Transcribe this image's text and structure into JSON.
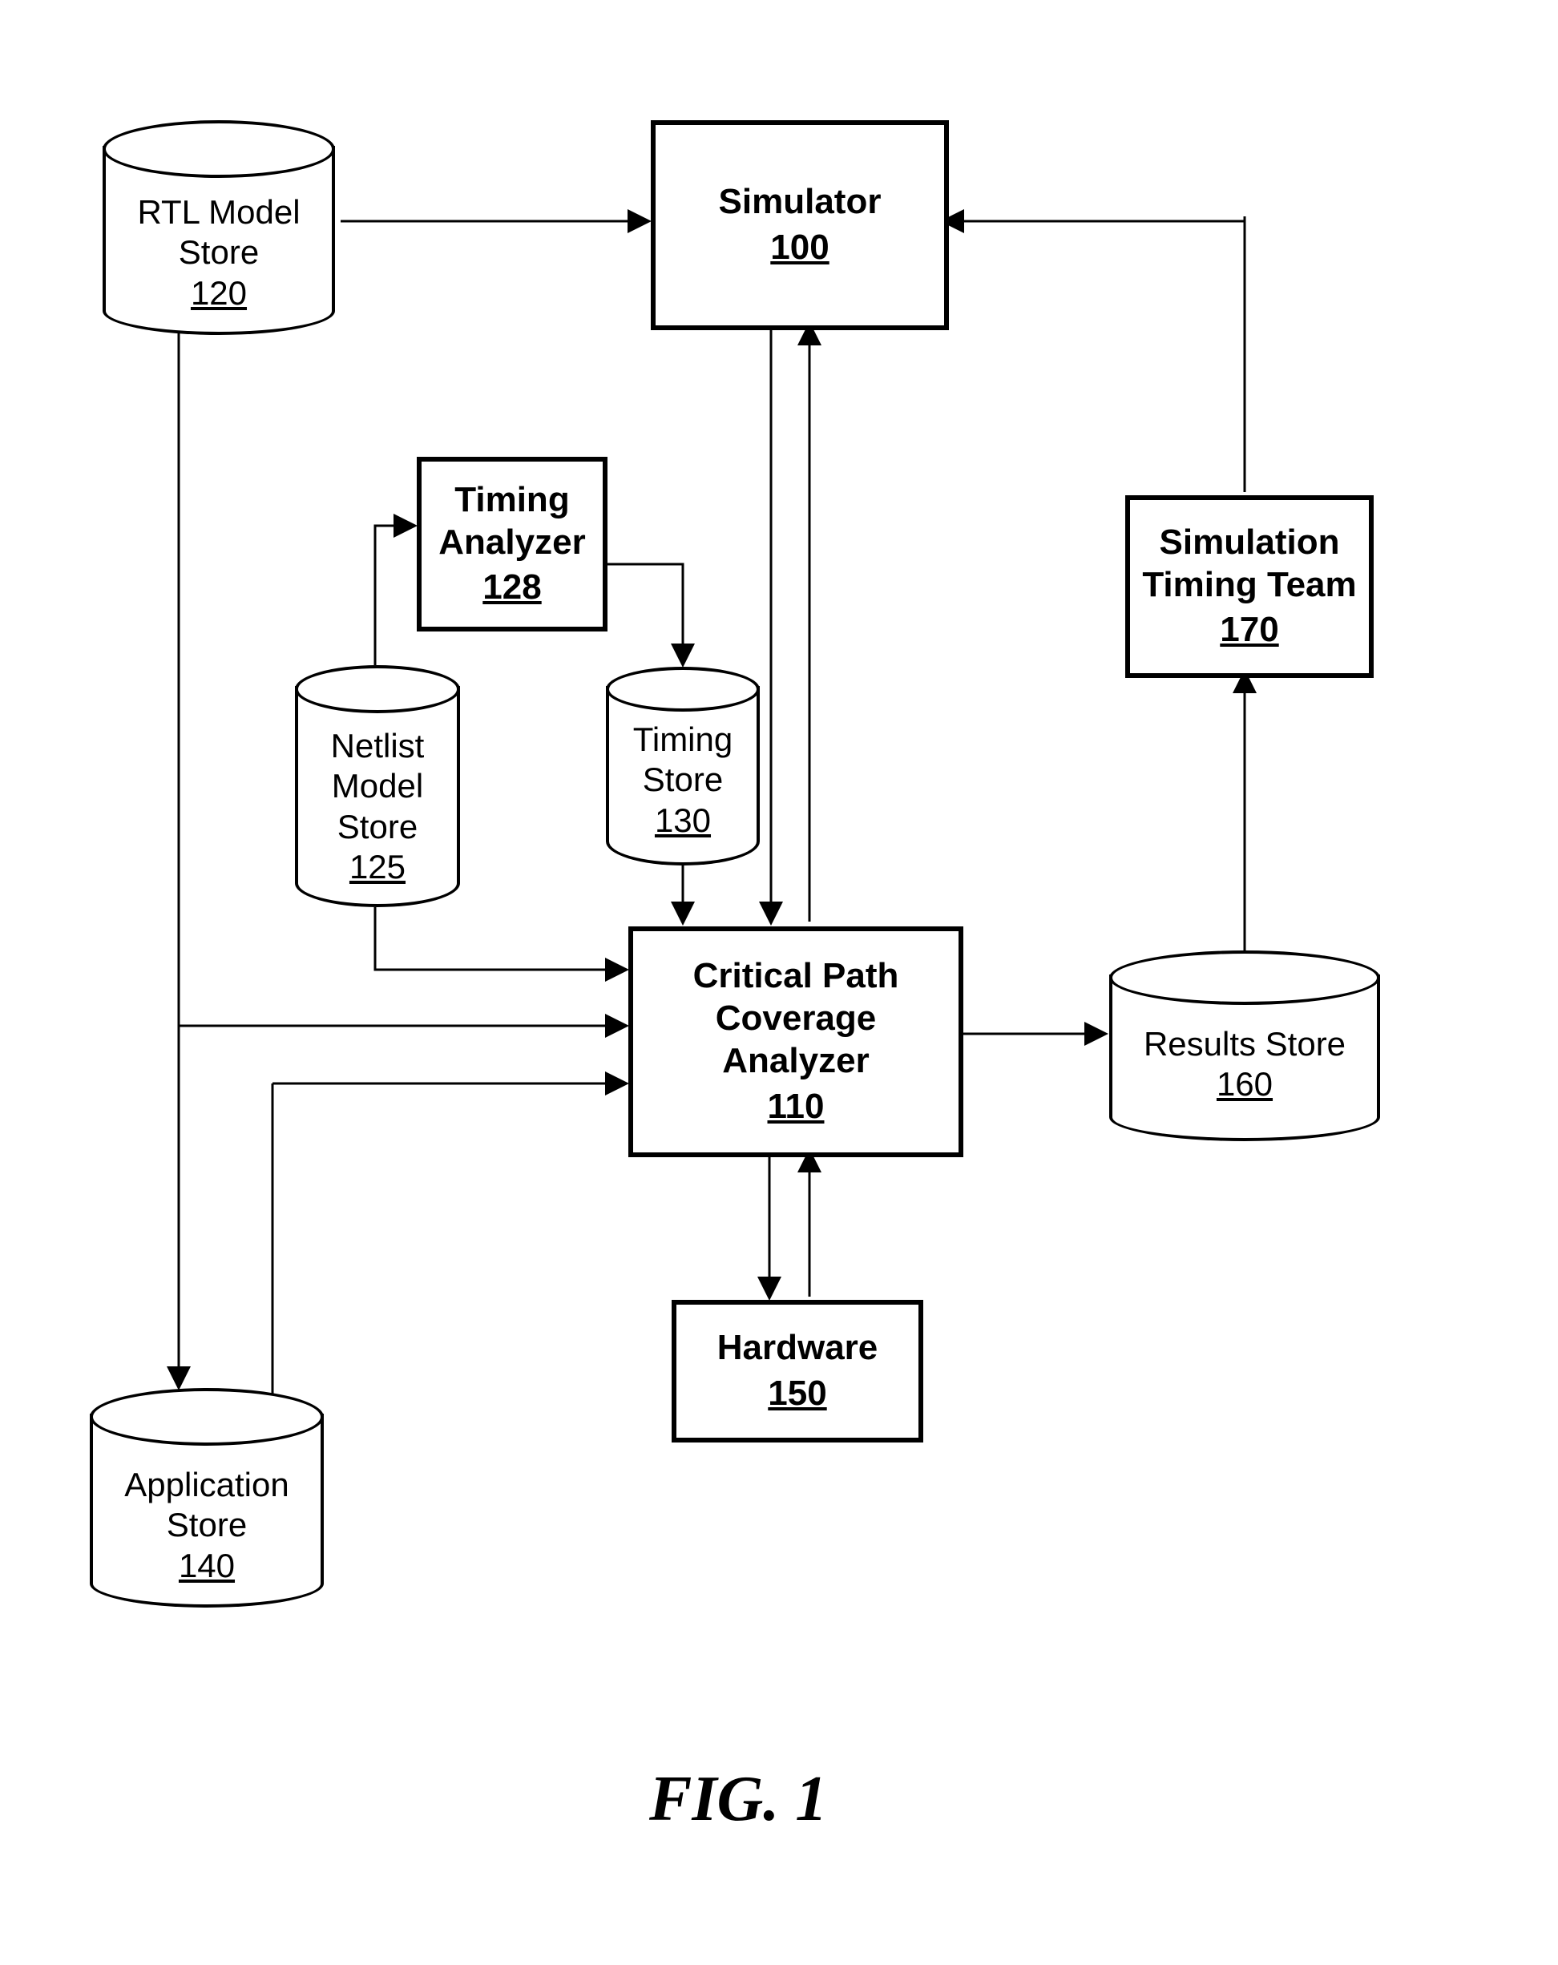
{
  "figure_label": "FIG. 1",
  "nodes": {
    "simulator": {
      "title": "Simulator",
      "num": "100"
    },
    "timing_analyzer": {
      "title_l1": "Timing",
      "title_l2": "Analyzer",
      "num": "128"
    },
    "simulation_timing_team": {
      "title_l1": "Simulation",
      "title_l2": "Timing Team",
      "num": "170"
    },
    "critical_path": {
      "title_l1": "Critical Path",
      "title_l2": "Coverage",
      "title_l3": "Analyzer",
      "num": "110"
    },
    "hardware": {
      "title": "Hardware",
      "num": "150"
    },
    "rtl_model_store": {
      "title_l1": "RTL Model",
      "title_l2": "Store",
      "num": "120"
    },
    "netlist_model_store": {
      "title_l1": "Netlist",
      "title_l2": "Model",
      "title_l3": "Store",
      "num": "125"
    },
    "timing_store": {
      "title_l1": "Timing",
      "title_l2": "Store",
      "num": "130"
    },
    "results_store": {
      "title_l1": "Results Store",
      "num": "160"
    },
    "application_store": {
      "title_l1": "Application",
      "title_l2": "Store",
      "num": "140"
    }
  }
}
